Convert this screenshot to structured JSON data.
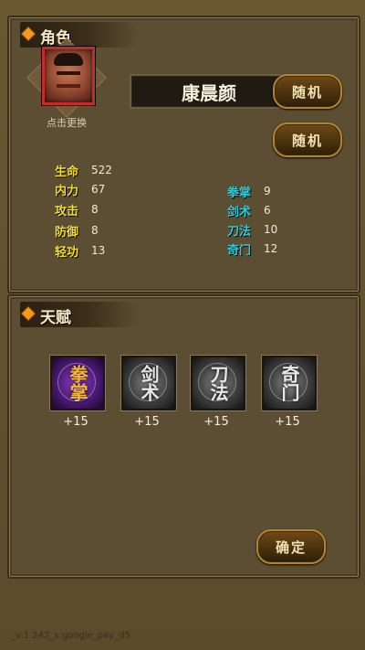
{
  "character_section": {
    "title": "角色",
    "portrait_caption": "点击更换",
    "name": "康晨颜",
    "random_name_button": "随机",
    "random_stats_button": "随机"
  },
  "stats_left": [
    {
      "label": "生命",
      "value": "522"
    },
    {
      "label": "内力",
      "value": "67"
    },
    {
      "label": "攻击",
      "value": "8"
    },
    {
      "label": "防御",
      "value": "8"
    },
    {
      "label": "轻功",
      "value": "13"
    }
  ],
  "stats_right": [
    {
      "label": "拳掌",
      "value": "9"
    },
    {
      "label": "剑术",
      "value": "6"
    },
    {
      "label": "刀法",
      "value": "10"
    },
    {
      "label": "奇门",
      "value": "12"
    }
  ],
  "talent_section": {
    "title": "天赋",
    "talents": [
      {
        "icon": "quanzhang-icon",
        "glyph": "拳掌",
        "bonus": "+15",
        "selected": true
      },
      {
        "icon": "jianshu-icon",
        "glyph": "剑术",
        "bonus": "+15",
        "selected": false
      },
      {
        "icon": "daofa-icon",
        "glyph": "刀法",
        "bonus": "+15",
        "selected": false
      },
      {
        "icon": "qimen-icon",
        "glyph": "奇门",
        "bonus": "+15",
        "selected": false
      }
    ],
    "confirm_button": "确定"
  },
  "footer": {
    "version": "_v:1.242_s:google_pay_d5"
  },
  "colors": {
    "primary_stat": "#f3de2a",
    "secondary_stat": "#33c9d6",
    "accent": "#f39a1a",
    "selected_talent": "#4b1a77"
  }
}
